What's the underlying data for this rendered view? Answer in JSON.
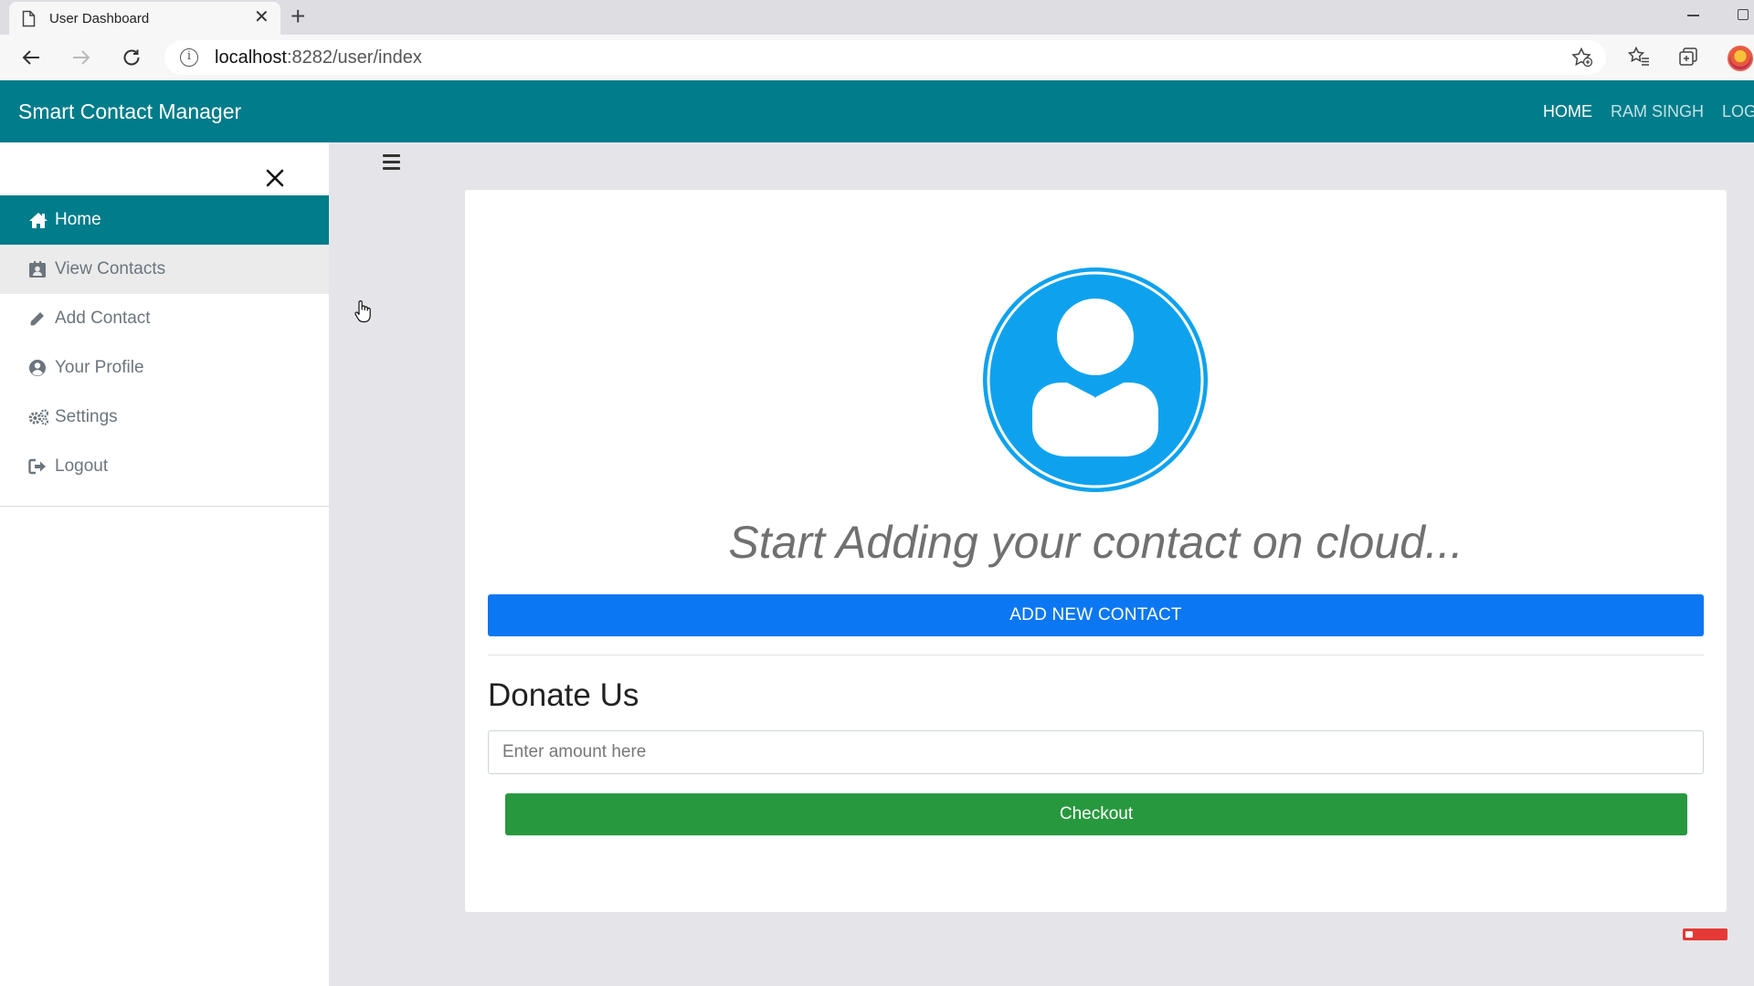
{
  "browser": {
    "tab_title": "User Dashboard",
    "url_host": "localhost",
    "url_rest": ":8282/user/index"
  },
  "navbar": {
    "brand": "Smart Contact Manager",
    "links": [
      {
        "label": "HOME",
        "active": true
      },
      {
        "label": "RAM SINGH",
        "active": false
      },
      {
        "label": "LOGOUT",
        "active": false
      }
    ]
  },
  "sidebar": {
    "items": [
      {
        "label": "Home",
        "icon": "home-icon",
        "state": "active"
      },
      {
        "label": "View Contacts",
        "icon": "address-book-icon",
        "state": "hover"
      },
      {
        "label": "Add Contact",
        "icon": "pencil-icon",
        "state": "normal"
      },
      {
        "label": "Your Profile",
        "icon": "user-circle-icon",
        "state": "normal"
      },
      {
        "label": "Settings",
        "icon": "cogs-icon",
        "state": "normal"
      },
      {
        "label": "Logout",
        "icon": "sign-out-icon",
        "state": "normal"
      }
    ]
  },
  "main": {
    "tagline": "Start Adding your contact on cloud...",
    "add_button": "ADD NEW CONTACT",
    "donate_heading": "Donate Us",
    "amount_placeholder": "Enter amount here",
    "checkout_button": "Checkout"
  },
  "colors": {
    "brand_teal": "#007c8a",
    "primary_blue": "#0b77f2",
    "success_green": "#28983f",
    "avatar_blue": "#0ea2ee"
  }
}
